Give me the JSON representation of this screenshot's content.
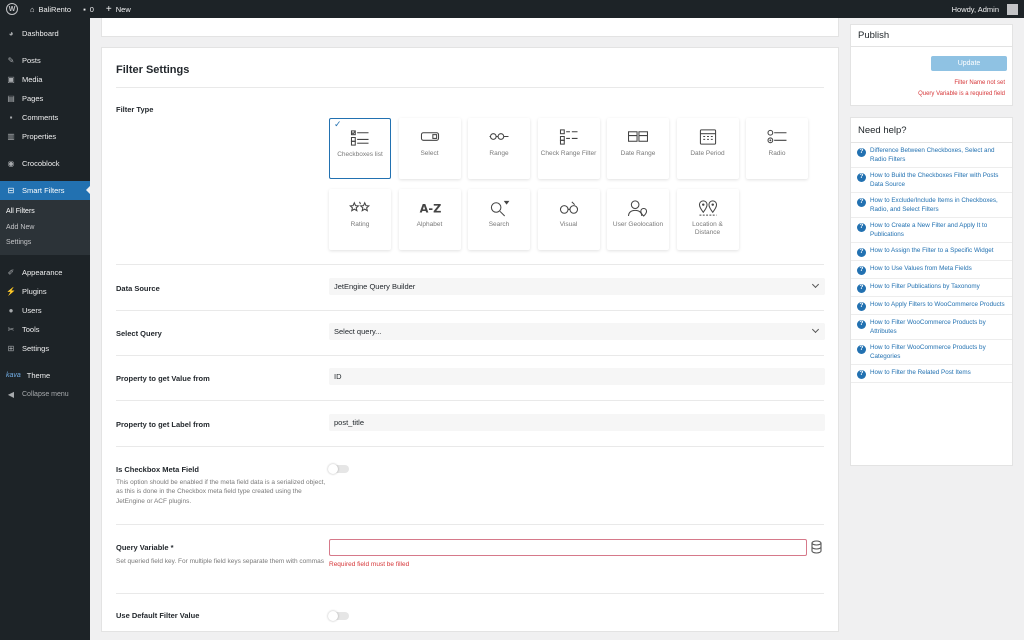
{
  "adminbar": {
    "site_name": "BaliRento",
    "comments_count": "0",
    "new_label": "New",
    "howdy": "Howdy, Admin"
  },
  "sidebar": {
    "items": [
      {
        "label": "Dashboard",
        "icon": "dashboard-icon"
      },
      {
        "label": "Posts",
        "icon": "pin-icon"
      },
      {
        "label": "Media",
        "icon": "media-icon"
      },
      {
        "label": "Pages",
        "icon": "page-icon"
      },
      {
        "label": "Comments",
        "icon": "comment-icon"
      },
      {
        "label": "Properties",
        "icon": "properties-icon"
      },
      {
        "label": "Crocoblock",
        "icon": "crocoblock-icon"
      },
      {
        "label": "Smart Filters",
        "icon": "smart-filters-icon"
      },
      {
        "label": "Appearance",
        "icon": "brush-icon"
      },
      {
        "label": "Plugins",
        "icon": "plugin-icon"
      },
      {
        "label": "Users",
        "icon": "users-icon"
      },
      {
        "label": "Tools",
        "icon": "wrench-icon"
      },
      {
        "label": "Settings",
        "icon": "settings-icon"
      },
      {
        "label": "Theme",
        "icon": "theme-icon"
      },
      {
        "label": "Collapse menu",
        "icon": "collapse-icon"
      }
    ],
    "submenu": [
      "All Filters",
      "Add New",
      "Settings"
    ],
    "theme_brand": "kava"
  },
  "filter_settings": {
    "title": "Filter Settings",
    "filter_type_label": "Filter Type",
    "filter_types": [
      {
        "label": "Checkboxes list",
        "icon": "checkboxes-icon",
        "selected": true
      },
      {
        "label": "Select",
        "icon": "select-icon",
        "selected": false
      },
      {
        "label": "Range",
        "icon": "range-icon",
        "selected": false
      },
      {
        "label": "Check Range Filter",
        "icon": "check-range-icon",
        "selected": false
      },
      {
        "label": "Date Range",
        "icon": "date-range-icon",
        "selected": false
      },
      {
        "label": "Date Period",
        "icon": "date-period-icon",
        "selected": false
      },
      {
        "label": "Radio",
        "icon": "radio-icon",
        "selected": false
      },
      {
        "label": "Rating",
        "icon": "rating-icon",
        "selected": false
      },
      {
        "label": "Alphabet",
        "icon": "alphabet-icon",
        "selected": false
      },
      {
        "label": "Search",
        "icon": "search-icon",
        "selected": false
      },
      {
        "label": "Visual",
        "icon": "visual-icon",
        "selected": false
      },
      {
        "label": "User Geolocation",
        "icon": "user-geolocation-icon",
        "selected": false
      },
      {
        "label": "Location & Distance",
        "icon": "location-distance-icon",
        "selected": false
      }
    ],
    "data_source": {
      "label": "Data Source",
      "value": "JetEngine Query Builder"
    },
    "select_query": {
      "label": "Select Query",
      "value": "Select query..."
    },
    "value_prop": {
      "label": "Property to get Value from",
      "value": "ID"
    },
    "label_prop": {
      "label": "Property to get Label from",
      "value": "post_title"
    },
    "checkbox_meta": {
      "label": "Is Checkbox Meta Field",
      "description": "This option should be enabled if the meta field data is a serialized object, as this is done in the Checkbox meta field type created using the JetEngine or ACF plugins.",
      "enabled": false
    },
    "query_variable": {
      "label": "Query Variable *",
      "description": "Set queried field key. For multiple field keys separate them with commas",
      "value": "",
      "error": "Required field must be filled"
    },
    "default_value": {
      "label": "Use Default Filter Value",
      "enabled": false
    }
  },
  "publish": {
    "title": "Publish",
    "update_label": "Update",
    "errors": [
      "Filter Name not set",
      "Query Variable is a required field"
    ]
  },
  "help": {
    "title": "Need help?",
    "links": [
      "Difference Between Checkboxes, Select and Radio Filters",
      "How to Build the Checkboxes Filter with Posts Data Source",
      "How to Exclude/Include Items in Checkboxes, Radio, and Select Filters",
      "How to Create a New Filter and Apply It to Publications",
      "How to Assign the Filter to a Specific Widget",
      "How to Use Values from Meta Fields",
      "How to Filter Publications by Taxonomy",
      "How to Apply Filters to WooCommerce Products",
      "How to Filter WooCommerce Products by Attributes",
      "How to Filter WooCommerce Products by Categories",
      "How to Filter the Related Post Items"
    ]
  },
  "colors": {
    "accent": "#2271b1",
    "sidebar_bg": "#1d2327",
    "error": "#d63638",
    "update_button": "#8fc2e3"
  }
}
